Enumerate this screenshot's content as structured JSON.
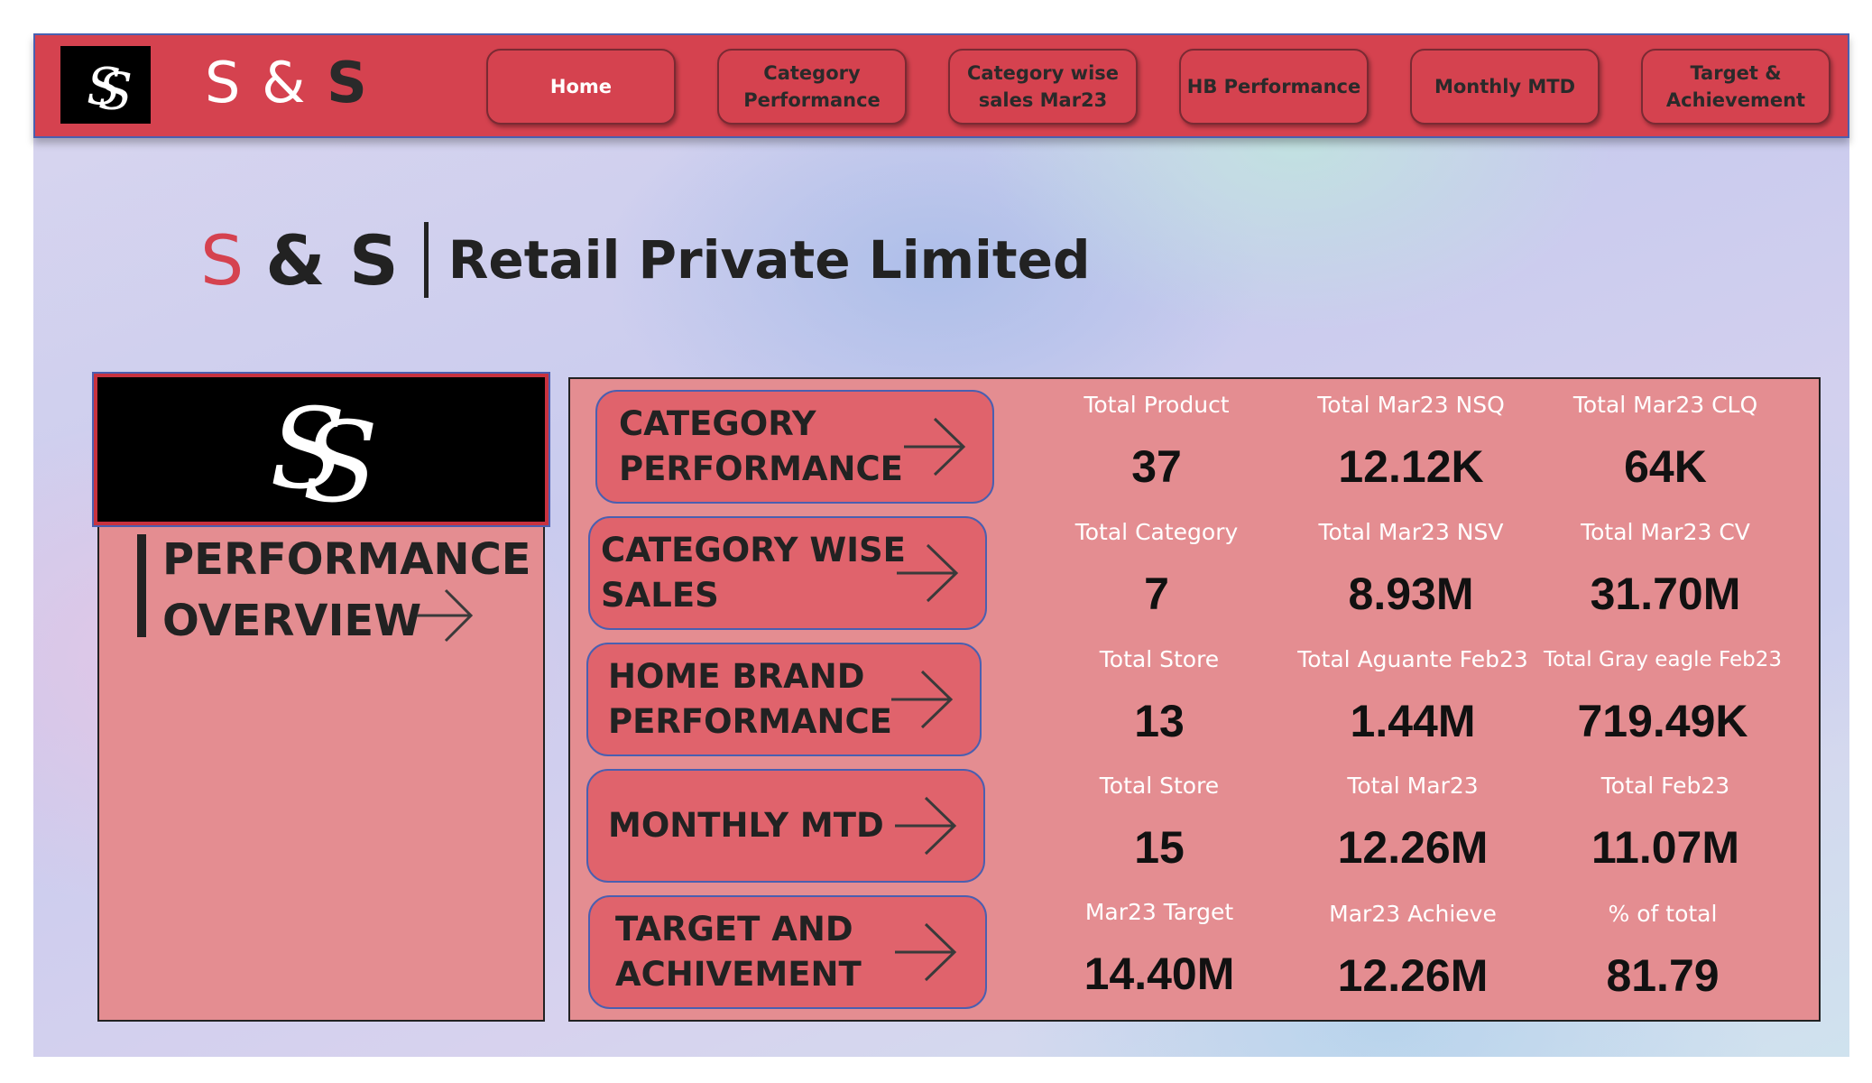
{
  "navbar": {
    "brand": {
      "s1": "S",
      "amp": "&",
      "s2": "S"
    },
    "buttons": [
      {
        "label": "Home",
        "active": true
      },
      {
        "label": "Category\nPerformance"
      },
      {
        "label": "Category wise\nsales Mar23"
      },
      {
        "label": "HB Performance"
      },
      {
        "label": "Monthly MTD"
      },
      {
        "label": "Target &\nAchievement"
      }
    ]
  },
  "company": {
    "s1": "S",
    "amp": "& S",
    "name": "Retail Private Limited"
  },
  "overview": {
    "title": "PERFORMANCE\nOVERVIEW"
  },
  "nav_cards": [
    {
      "label": "CATEGORY\nPERFORMANCE"
    },
    {
      "label": "CATEGORY WISE\nSALES"
    },
    {
      "label": "HOME BRAND\nPERFORMANCE"
    },
    {
      "label": "MONTHLY MTD"
    },
    {
      "label": "TARGET AND\nACHIVEMENT"
    }
  ],
  "kpis": [
    {
      "label": "Total Product",
      "value": "37"
    },
    {
      "label": "Total Mar23 NSQ",
      "value": "12.12K"
    },
    {
      "label": "Total Mar23 CLQ",
      "value": "64K"
    },
    {
      "label": "Total Category",
      "value": "7"
    },
    {
      "label": "Total Mar23 NSV",
      "value": "8.93M"
    },
    {
      "label": "Total Mar23 CV",
      "value": "31.70M"
    },
    {
      "label": "Total Store",
      "value": "13"
    },
    {
      "label": "Total Aguante Feb23",
      "value": "1.44M"
    },
    {
      "label": "Total Gray eagle Feb23",
      "value": "719.49K"
    },
    {
      "label": "Total Store",
      "value": "15"
    },
    {
      "label": "Total Mar23",
      "value": "12.26M"
    },
    {
      "label": "Total Feb23",
      "value": "11.07M"
    },
    {
      "label": "Mar23 Target",
      "value": "14.40M"
    },
    {
      "label": "Mar23 Achieve",
      "value": "12.26M"
    },
    {
      "label": "% of total",
      "value": "81.79"
    }
  ],
  "colors": {
    "accent": "#d5424f",
    "panel": "#e48d91",
    "card": "#e0636c",
    "border": "#4a5fb0"
  }
}
